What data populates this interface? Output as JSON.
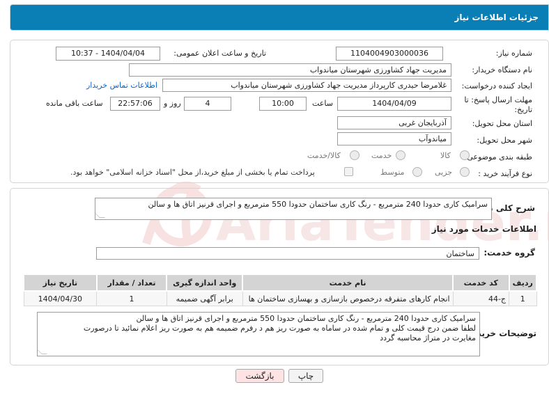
{
  "header": {
    "title": "جزئیات اطلاعات نیاز"
  },
  "fields": {
    "need_number_label": "شماره نیاز:",
    "need_number": "1104004903000036",
    "announce_label": "تاریخ و ساعت اعلان عمومی:",
    "announce_value": "1404/04/04 - 10:37",
    "buyer_org_label": "نام دستگاه خریدار:",
    "buyer_org": "مدیریت جهاد کشاورزی شهرستان میاندواب",
    "creator_label": "ایجاد کننده درخواست:",
    "creator": "غلامرضا حیدری کارپرداز مدیریت جهاد کشاورزی شهرستان میاندواب",
    "contact_link": "اطلاعات تماس خریدار",
    "deadline_label_1": "مهلت ارسال پاسخ: تا",
    "deadline_label_2": "تاریخ:",
    "deadline_date": "1404/04/09",
    "time_label": "ساعت",
    "deadline_time": "10:00",
    "days_value": "4",
    "days_label": "روز و",
    "remaining_time": "22:57:06",
    "remaining_label": "ساعت باقی مانده",
    "province_label": "استان محل تحویل:",
    "province": "آذربایجان غربی",
    "city_label": "شهر محل تحویل:",
    "city": "میاندوآب",
    "category_label": "طبقه بندی موضوعی:",
    "category_options": [
      "کالا",
      "خدمت",
      "کالا/خدمت"
    ],
    "process_label": "نوع فرآیند خرید :",
    "process_options": [
      "جزیی",
      "متوسط"
    ],
    "payment_note": "پرداخت تمام یا بخشی از مبلغ خرید،از محل \"اسناد خزانه اسلامی\" خواهد بود."
  },
  "summary": {
    "label": "شرح کلی نیاز:",
    "text": "سرامیک کاری حدودا 240 مترمربع - رنگ کاری ساختمان حدودا 550 مترمربع و اجرای قرنیز اتاق ها و سالن"
  },
  "services": {
    "section_title": "اطلاعات خدمات مورد نیاز",
    "group_label": "گروه خدمت:",
    "group_value": "ساختمان",
    "columns": [
      "ردیف",
      "کد خدمت",
      "نام خدمت",
      "واحد اندازه گیری",
      "تعداد / مقدار",
      "تاریخ نیاز"
    ],
    "rows": [
      {
        "row": "1",
        "code": "ج-44",
        "name": "انجام کارهای متفرقه درخصوص بازسازی و بهسازی ساختمان ها",
        "unit": "برابر آگهی ضمیمه",
        "qty": "1",
        "date": "1404/04/30"
      }
    ]
  },
  "notes": {
    "label": "توضیحات خریدار:",
    "line1": "سرامیک کاری حدودا 240 مترمربع - رنگ کاری ساختمان حدودا 550 مترمربع و اجرای قرنیز اتاق ها و سالن",
    "line2": "لطفا ضمن درج قیمت کلی و تمام شده در ساماه به صورت ریز هم د رفرم ضمیمه هم به صورت ریز اعلام نمائید تا درصورت",
    "line3": "مغایرت در متراژ محاسبه گردد"
  },
  "buttons": {
    "print": "چاپ",
    "back": "بازگشت"
  },
  "watermark": {
    "brand": "AriaTender.neT"
  },
  "colors": {
    "header": "#0a7fb5",
    "back_button": "#fde3e3",
    "link": "#0a63c9"
  }
}
